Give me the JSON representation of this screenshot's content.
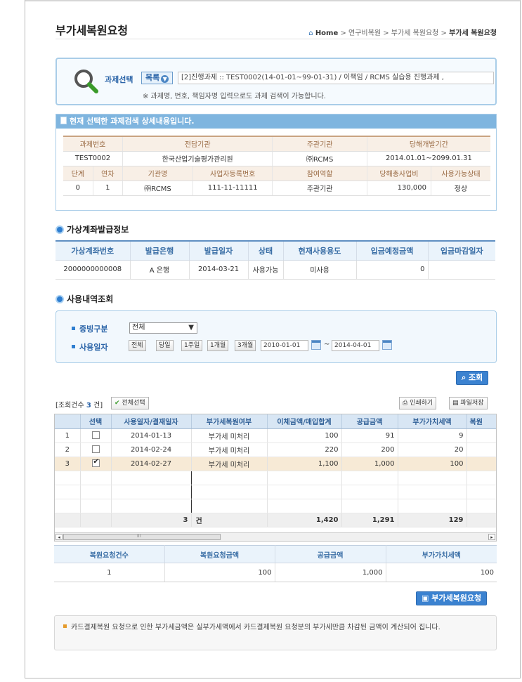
{
  "page": {
    "title": "부가세복원요청"
  },
  "breadcrumb": {
    "home": "Home",
    "items": [
      "연구비복원",
      "부가세 복원요청"
    ],
    "current": "부가세 복원요청"
  },
  "project_select": {
    "label": "과제선택",
    "list_button": "목록",
    "value": "[2]진행과제 :: TEST0002(14-01-01~99-01-31) / 이책임 / RCMS 실습용 진행과제 ,",
    "note": "※ 과제명, 번호, 책임자명 입력으로도 과제 검색이 가능합니다."
  },
  "detail": {
    "header": "현재 선택한 과제검색 상세내용입니다.",
    "row1_headers": [
      "과제번호",
      "전담기관",
      "주관기관",
      "당해개발기간"
    ],
    "row1_values": [
      "TEST0002",
      "한국산업기술평가관리원",
      "㈜RCMS",
      "2014.01.01~2099.01.31"
    ],
    "row2_headers": [
      "단계",
      "연차",
      "기관명",
      "사업자등록번호",
      "참여역할",
      "당해총사업비",
      "사용가능상태"
    ],
    "row2_values": [
      "0",
      "1",
      "㈜RCMS",
      "111-11-11111",
      "주관기관",
      "130,000",
      "정상"
    ]
  },
  "virtual_account": {
    "section_title": "가상계좌발급정보",
    "headers": [
      "가상계좌번호",
      "발급은행",
      "발급일자",
      "상태",
      "현재사용용도",
      "입금예정금액",
      "입금마감일자"
    ],
    "row": [
      "2000000000008",
      "A 은행",
      "2014-03-21",
      "사용가능",
      "미사용",
      "0",
      ""
    ]
  },
  "usage": {
    "section_title": "사용내역조회",
    "evidence_label": "증빙구분",
    "evidence_value": "전체",
    "date_label": "사용일자",
    "period_buttons": [
      "전체",
      "당일",
      "1주일",
      "1개월",
      "3개월"
    ],
    "date_from": "2010-01-01",
    "tilde": "~",
    "date_to": "2014-04-01",
    "search_button": "조회"
  },
  "results": {
    "count_prefix": "[조회건수",
    "count": "3",
    "count_suffix": "건]",
    "select_all": "전체선택",
    "print": "인쇄하기",
    "save_file": "파일저장",
    "headers": [
      "",
      "선택",
      "사용일자/결재일자",
      "부가세복원여부",
      "이체금액/매입합계",
      "공급금액",
      "부가가치세액",
      "복원"
    ],
    "rows": [
      {
        "no": "1",
        "checked": false,
        "date": "2014-01-13",
        "status": "부가세 미처리",
        "total": "100",
        "supply": "91",
        "vat": "9"
      },
      {
        "no": "2",
        "checked": false,
        "date": "2014-02-24",
        "status": "부가세 미처리",
        "total": "220",
        "supply": "200",
        "vat": "20"
      },
      {
        "no": "3",
        "checked": true,
        "date": "2014-02-27",
        "status": "부가세 미처리",
        "total": "1,100",
        "supply": "1,000",
        "vat": "100"
      }
    ],
    "summary": {
      "count": "3",
      "unit": "건",
      "total": "1,420",
      "supply": "1,291",
      "vat": "129"
    },
    "scroll_mark": "III"
  },
  "restore": {
    "headers": [
      "복원요청건수",
      "복원요청금액",
      "공급금액",
      "부가가치세액"
    ],
    "values": [
      "1",
      "100",
      "1,000",
      "100"
    ],
    "button": "부가세복원요청"
  },
  "notice": "카드결제복원 요청으로 인한 부가세금액은 실부가세액에서 카드결제복원 요청분의 부가세만큼 차감된 금액이 계산되어 집니다."
}
